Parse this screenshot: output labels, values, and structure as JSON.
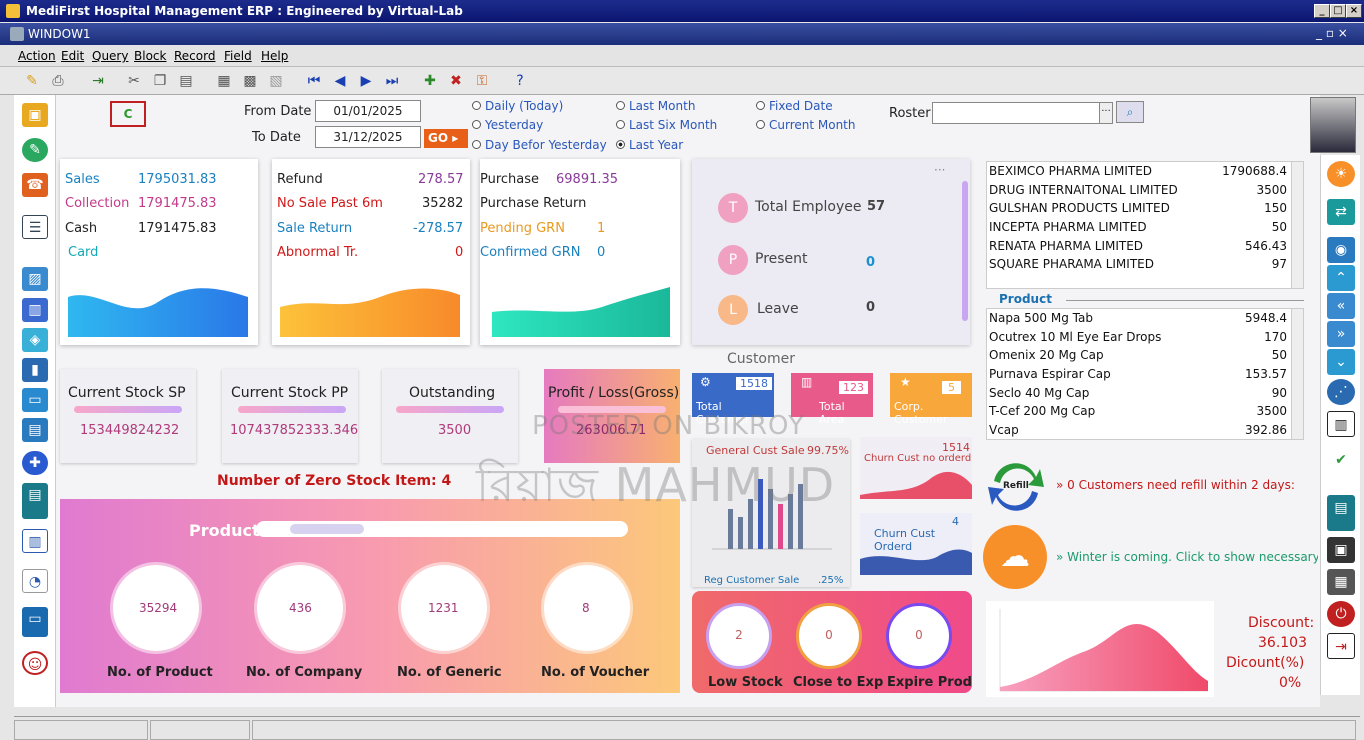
{
  "app": {
    "title": "MediFirst Hospital Management ERP : Engineered by Virtual-Lab",
    "window": "WINDOW1"
  },
  "menu": [
    "Action",
    "Edit",
    "Query",
    "Block",
    "Record",
    "Field",
    "Help"
  ],
  "filters": {
    "from_label": "From Date",
    "from_value": "01/01/2025",
    "to_label": "To Date",
    "to_value": "31/12/2025",
    "go": "GO",
    "radios": [
      {
        "label": "Daily (Today)",
        "on": false
      },
      {
        "label": "Yesterday",
        "on": false
      },
      {
        "label": "Day Befor Yesterday",
        "on": false
      },
      {
        "label": "Last Month",
        "on": false
      },
      {
        "label": "Last Six Month",
        "on": false
      },
      {
        "label": "Last Year",
        "on": true
      },
      {
        "label": "Fixed Date",
        "on": false
      },
      {
        "label": "Current Month",
        "on": false
      }
    ],
    "roster_label": "Roster",
    "roster_value": ""
  },
  "sales": {
    "sales_l": "Sales",
    "sales_v": "1795031.83",
    "collection_l": "Collection",
    "collection_v": "1791475.83",
    "cash_l": "Cash",
    "cash_v": "1791475.83",
    "card_l": "Card"
  },
  "refund": {
    "refund_l": "Refund",
    "refund_v": "278.57",
    "nosale_l": "No Sale Past 6m",
    "nosale_v": "35282",
    "salereturn_l": "Sale Return",
    "salereturn_v": "-278.57",
    "abnormal_l": "Abnormal Tr.",
    "abnormal_v": "0"
  },
  "purchase": {
    "purchase_l": "Purchase",
    "purchase_v": "69891.35",
    "preturn_l": "Purchase Return",
    "pending_l": "Pending GRN",
    "pending_v": "1",
    "confirmed_l": "Confirmed GRN",
    "confirmed_v": "0"
  },
  "employee": {
    "total_l": "Total Employee",
    "total_v": "57",
    "present_l": "Present",
    "present_v": "0",
    "leave_l": "Leave",
    "leave_v": "0",
    "t": "T",
    "p": "P",
    "l": "L"
  },
  "stock": {
    "sp_l": "Current Stock SP",
    "sp_v": "153449824232",
    "pp_l": "Current Stock PP",
    "pp_v": "107437852333.346",
    "out_l": "Outstanding",
    "out_v": "3500",
    "pl_l": "Profit / Loss(Gross)",
    "pl_v": "263006.71",
    "zero": "Number of Zero Stock Item: 4"
  },
  "product": {
    "title": "Product",
    "items": [
      {
        "v": "35294",
        "l": "No. of Product"
      },
      {
        "v": "436",
        "l": "No. of Company"
      },
      {
        "v": "1231",
        "l": "No. of Generic"
      },
      {
        "v": "8",
        "l": "No. of Voucher"
      }
    ]
  },
  "customer": {
    "title": "Customer",
    "total_v": "1518",
    "total_l": "Total Customer",
    "area_v": "123",
    "area_l": "Total Area",
    "corp_v": "5",
    "corp_l": "Corp. Customer",
    "general_l": "General Cust Sale",
    "general_v": "99.75%",
    "churn_v": "1514",
    "churn_l": "Churn Cust no orderd",
    "churnord_v": "4",
    "churnord_l": "Churn Cust Orderd",
    "reg_l": "Reg Customer Sale",
    "reg_v": ".25%"
  },
  "stockalerts": [
    {
      "v": "2",
      "l": "Low Stock"
    },
    {
      "v": "0",
      "l": "Close to Exp"
    },
    {
      "v": "0",
      "l": "Expire Prod"
    }
  ],
  "companies": [
    {
      "n": "BEXIMCO PHARMA LIMITED",
      "v": "1790688.4"
    },
    {
      "n": "DRUG INTERNAITONAL LIMITED",
      "v": "3500"
    },
    {
      "n": "GULSHAN PRODUCTS LIMITED",
      "v": "150"
    },
    {
      "n": "INCEPTA PHARMA LIMITED",
      "v": "50"
    },
    {
      "n": "RENATA  PHARMA LIMITED",
      "v": "546.43"
    },
    {
      "n": "SQUARE PHARAMA LIMITED",
      "v": "97"
    }
  ],
  "products_title": "Product",
  "products": [
    {
      "n": "Napa 500 Mg Tab",
      "v": "5948.4"
    },
    {
      "n": "Ocutrex 10 Ml Eye Ear Drops",
      "v": "170"
    },
    {
      "n": "Omenix 20 Mg Cap",
      "v": "50"
    },
    {
      "n": "Purnava Espirar Cap",
      "v": "153.57"
    },
    {
      "n": "Seclo 40 Mg Cap",
      "v": "90"
    },
    {
      "n": "T-Cef  200 Mg Cap",
      "v": "3500"
    },
    {
      "n": "Vcap",
      "v": "392.86"
    }
  ],
  "refill": {
    "icon_text": "Refill",
    "msg": "» 0 Customers need refill within 2 days:"
  },
  "weather": {
    "msg": "» Winter is coming. Click to show necessary pro"
  },
  "discount": {
    "l": "Discount:",
    "v": "36.103",
    "pl": "Dicount(%)",
    "pv": "0%"
  },
  "watermark": {
    "line1": "POSTED ON BIKROY",
    "line2": "রিয়াজ MAHMUD"
  },
  "colors": {
    "title": "#0a1670",
    "pink": "#c43a8a",
    "blue": "#1a80c0",
    "red": "#d01818"
  }
}
